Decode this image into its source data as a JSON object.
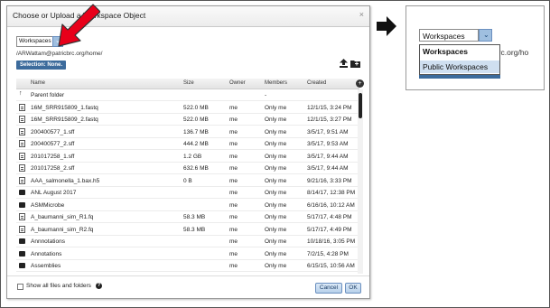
{
  "dialog": {
    "title": "Choose or Upload a Workspace Object",
    "close": "×",
    "workspace_select": {
      "value": "Workspaces",
      "chevron": "⌄"
    },
    "path": "/ARWattam@patricbrc.org/home/",
    "selection_badge": "Selection: None.",
    "toolbar": {
      "upload_icon": "upload-icon",
      "new_folder_icon": "new-folder-icon"
    },
    "columns": {
      "name": "Name",
      "size": "Size",
      "owner": "Owner",
      "members": "Members",
      "created": "Created"
    },
    "column_toggle": "+",
    "rows": [
      {
        "icon": "up",
        "name": "Parent folder",
        "size": "",
        "owner": "",
        "members": "-",
        "created": ""
      },
      {
        "icon": "file",
        "name": "16M_SRR915809_1.fastq",
        "size": "522.0 MB",
        "owner": "me",
        "members": "Only me",
        "created": "12/1/15, 3:24 PM"
      },
      {
        "icon": "file",
        "name": "16M_SRR915809_2.fastq",
        "size": "522.0 MB",
        "owner": "me",
        "members": "Only me",
        "created": "12/1/15, 3:27 PM"
      },
      {
        "icon": "file",
        "name": "200400577_1.sff",
        "size": "136.7 MB",
        "owner": "me",
        "members": "Only me",
        "created": "3/5/17, 9:51 AM"
      },
      {
        "icon": "file",
        "name": "200400577_2.sff",
        "size": "444.2 MB",
        "owner": "me",
        "members": "Only me",
        "created": "3/5/17, 9:53 AM"
      },
      {
        "icon": "file",
        "name": "201017258_1.sff",
        "size": "1.2 GB",
        "owner": "me",
        "members": "Only me",
        "created": "3/5/17, 9:44 AM"
      },
      {
        "icon": "file",
        "name": "201017258_2.sff",
        "size": "632.6 MB",
        "owner": "me",
        "members": "Only me",
        "created": "3/5/17, 9:44 AM"
      },
      {
        "icon": "file",
        "name": "AAA_salmonella_1.bax.h5",
        "size": "0 B",
        "owner": "me",
        "members": "Only me",
        "created": "9/21/16, 3:33 PM"
      },
      {
        "icon": "folder",
        "name": "ANL August 2017",
        "size": "",
        "owner": "me",
        "members": "Only me",
        "created": "8/14/17, 12:38 PM"
      },
      {
        "icon": "folder",
        "name": "ASMMicrobe",
        "size": "",
        "owner": "me",
        "members": "Only me",
        "created": "6/16/16, 10:12 AM"
      },
      {
        "icon": "file",
        "name": "A_baumanni_sim_R1.fq",
        "size": "58.3 MB",
        "owner": "me",
        "members": "Only me",
        "created": "5/17/17, 4:48 PM"
      },
      {
        "icon": "file",
        "name": "A_baumanni_sim_R2.fq",
        "size": "58.3 MB",
        "owner": "me",
        "members": "Only me",
        "created": "5/17/17, 4:49 PM"
      },
      {
        "icon": "folder",
        "name": "Annnotations",
        "size": "",
        "owner": "me",
        "members": "Only me",
        "created": "10/18/16, 3:05 PM"
      },
      {
        "icon": "folder",
        "name": "Annotations",
        "size": "",
        "owner": "me",
        "members": "Only me",
        "created": "7/2/15, 4:28 PM"
      },
      {
        "icon": "folder",
        "name": "Assemblies",
        "size": "",
        "owner": "me",
        "members": "Only me",
        "created": "6/15/15, 10:56 AM"
      }
    ],
    "footer": {
      "show_all_label": "Show all files and folders",
      "help": "?",
      "cancel_label": "Cancel",
      "ok_label": "OK"
    }
  },
  "annotations": {
    "red_arrow_color": "#e8001a",
    "black_arrow_color": "#111111"
  },
  "zoom_panel": {
    "select_value": "Workspaces",
    "chevron": "⌄",
    "options": [
      "Workspaces",
      "Public Workspaces"
    ],
    "path_fragment": "orc.org/ho"
  }
}
